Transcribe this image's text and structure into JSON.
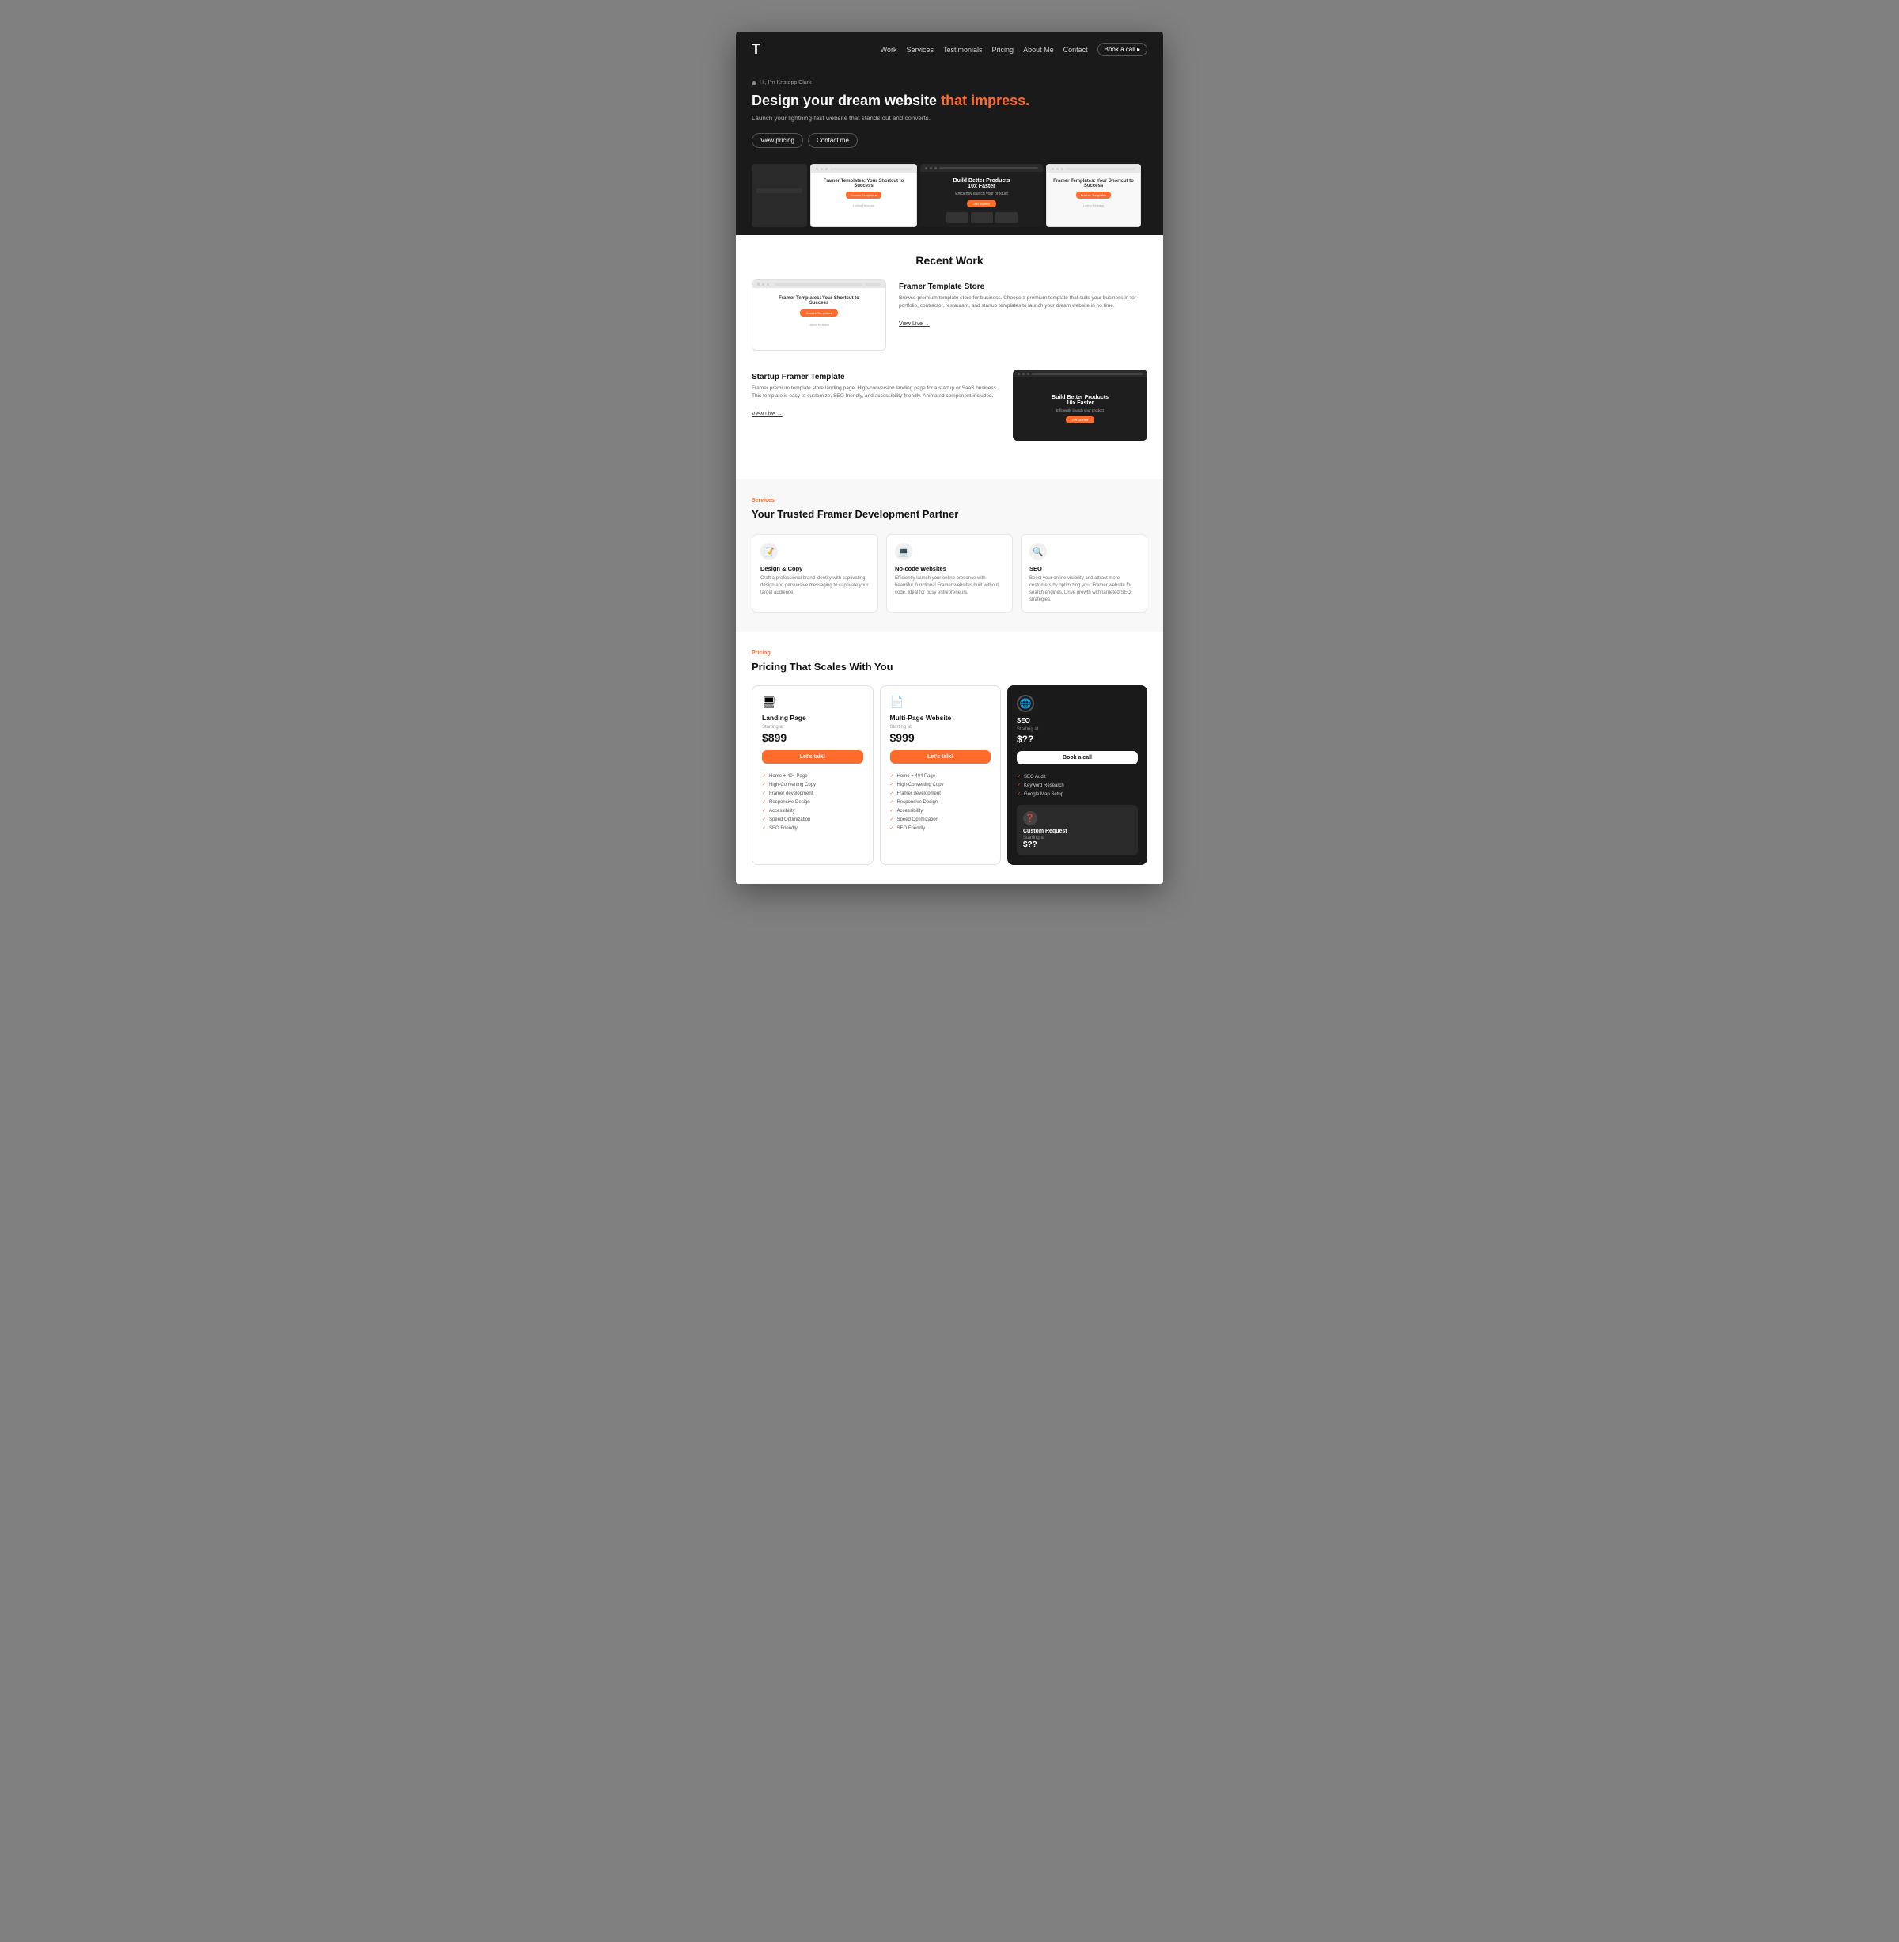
{
  "nav": {
    "logo": "T",
    "links": [
      "Work",
      "Services",
      "Testimonials",
      "Pricing",
      "About Me",
      "Contact"
    ],
    "cta_label": "Book a call ▸"
  },
  "hero": {
    "badge_text": "Hi, I'm Kristopp Clark",
    "title_start": "Design your dream website ",
    "title_highlight": "that impress.",
    "subtitle": "Launch your lightning-fast website that stands out and converts.",
    "btn_pricing": "View pricing",
    "btn_contact": "Contact me"
  },
  "recent_work": {
    "section_title": "Recent Work",
    "items": [
      {
        "title": "Framer Template Store",
        "description": "Browse premium template store for business. Choose a premium template that suits your business in for portfolio, contractor, restaurant, and startup templates to launch your dream website in no time.",
        "link": "View Live →"
      },
      {
        "title": "Startup Framer Template",
        "description": "Framer premium template store landing page. High-conversion landing page for a startup or SaaS business. This template is easy to customize, SEO-friendly, and accessibility-friendly. Animated component included.",
        "link": "View Live →"
      }
    ]
  },
  "services": {
    "label": "Services",
    "title": "Your Trusted Framer Development Partner",
    "items": [
      {
        "icon": "📝",
        "name": "Design & Copy",
        "description": "Craft a professional brand identity with captivating design and persuasive messaging to captivate your target audience."
      },
      {
        "icon": "💻",
        "name": "No-code Websites",
        "description": "Efficiently launch your online presence with beautiful, functional Framer websites built without code. Ideal for busy entrepreneurs."
      },
      {
        "icon": "🔍",
        "name": "SEO",
        "description": "Boost your online visibility and attract more customers by optimizing your Framer website for search engines. Drive growth with targeted SEO strategies."
      }
    ]
  },
  "pricing": {
    "label": "Pricing",
    "title": "Pricing That Scales With You",
    "plans": [
      {
        "icon": "🖥",
        "name": "Landing Page",
        "starting_at": "Starting at",
        "price": "$899",
        "cta": "Let's talk!",
        "features": [
          "Home + 404 Page",
          "High-Converting Copy",
          "Framer development",
          "Responsive Design",
          "Accessibility",
          "Speed Optimization",
          "SEO Friendly"
        ]
      },
      {
        "icon": "📄",
        "name": "Multi-Page Website",
        "starting_at": "Starting at",
        "price": "$999",
        "cta": "Let's talk!",
        "features": [
          "Home + 404 Page",
          "High-Converting Copy",
          "Framer development",
          "Responsive Design",
          "Accessibility",
          "Speed Optimization",
          "SEO Friendly"
        ]
      },
      {
        "name": "SEO",
        "starting_at": "Starting at",
        "price": "$??",
        "cta": "Book a call",
        "features": [
          "SEO Audit",
          "Keyword Research",
          "Google Map Setup"
        ]
      }
    ],
    "custom": {
      "name": "Custom Request",
      "starting_at": "Starting at",
      "price": "$??"
    }
  }
}
